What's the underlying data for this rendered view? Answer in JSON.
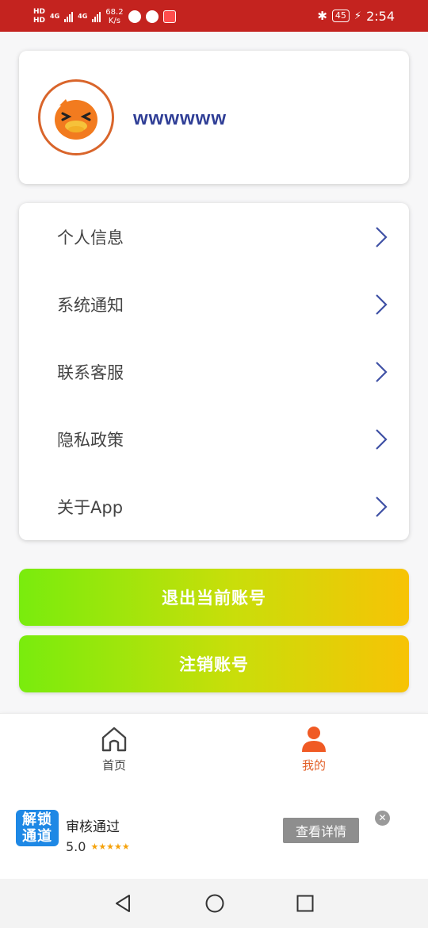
{
  "status_bar": {
    "hd1": "HD",
    "hd2": "HD",
    "net1": "4G",
    "net2": "4G",
    "speed_value": "68.2",
    "speed_unit": "K/s",
    "battery": "45",
    "time": "2:54",
    "bluetooth_icon": "bluetooth-icon",
    "background": "#c4231f"
  },
  "profile": {
    "avatar_icon": "duck-avatar-icon",
    "username": "wwwwww"
  },
  "menu": {
    "items": [
      {
        "label": "个人信息"
      },
      {
        "label": "系统通知"
      },
      {
        "label": "联系客服"
      },
      {
        "label": "隐私政策"
      },
      {
        "label": "关于App"
      }
    ],
    "chevron_color": "#3f51a5"
  },
  "actions": {
    "logout_label": "退出当前账号",
    "cancel_account_label": "注销账号",
    "gradient": [
      "#79ec0d",
      "#f7c305"
    ]
  },
  "tabbar": {
    "tabs": [
      {
        "label": "首页",
        "icon": "home-icon",
        "active": false
      },
      {
        "label": "我的",
        "icon": "person-icon",
        "active": true
      }
    ],
    "active_color": "#e2612a"
  },
  "ad": {
    "logo_line1": "解锁",
    "logo_line2": "通道",
    "title": "审核通过",
    "rating": "5.0",
    "stars": "★★★★★",
    "button_label": "查看详情",
    "close_glyph": "✕"
  },
  "system_nav": {
    "back_icon": "back-triangle-icon",
    "home_icon": "home-circle-icon",
    "recents_icon": "recents-square-icon"
  }
}
